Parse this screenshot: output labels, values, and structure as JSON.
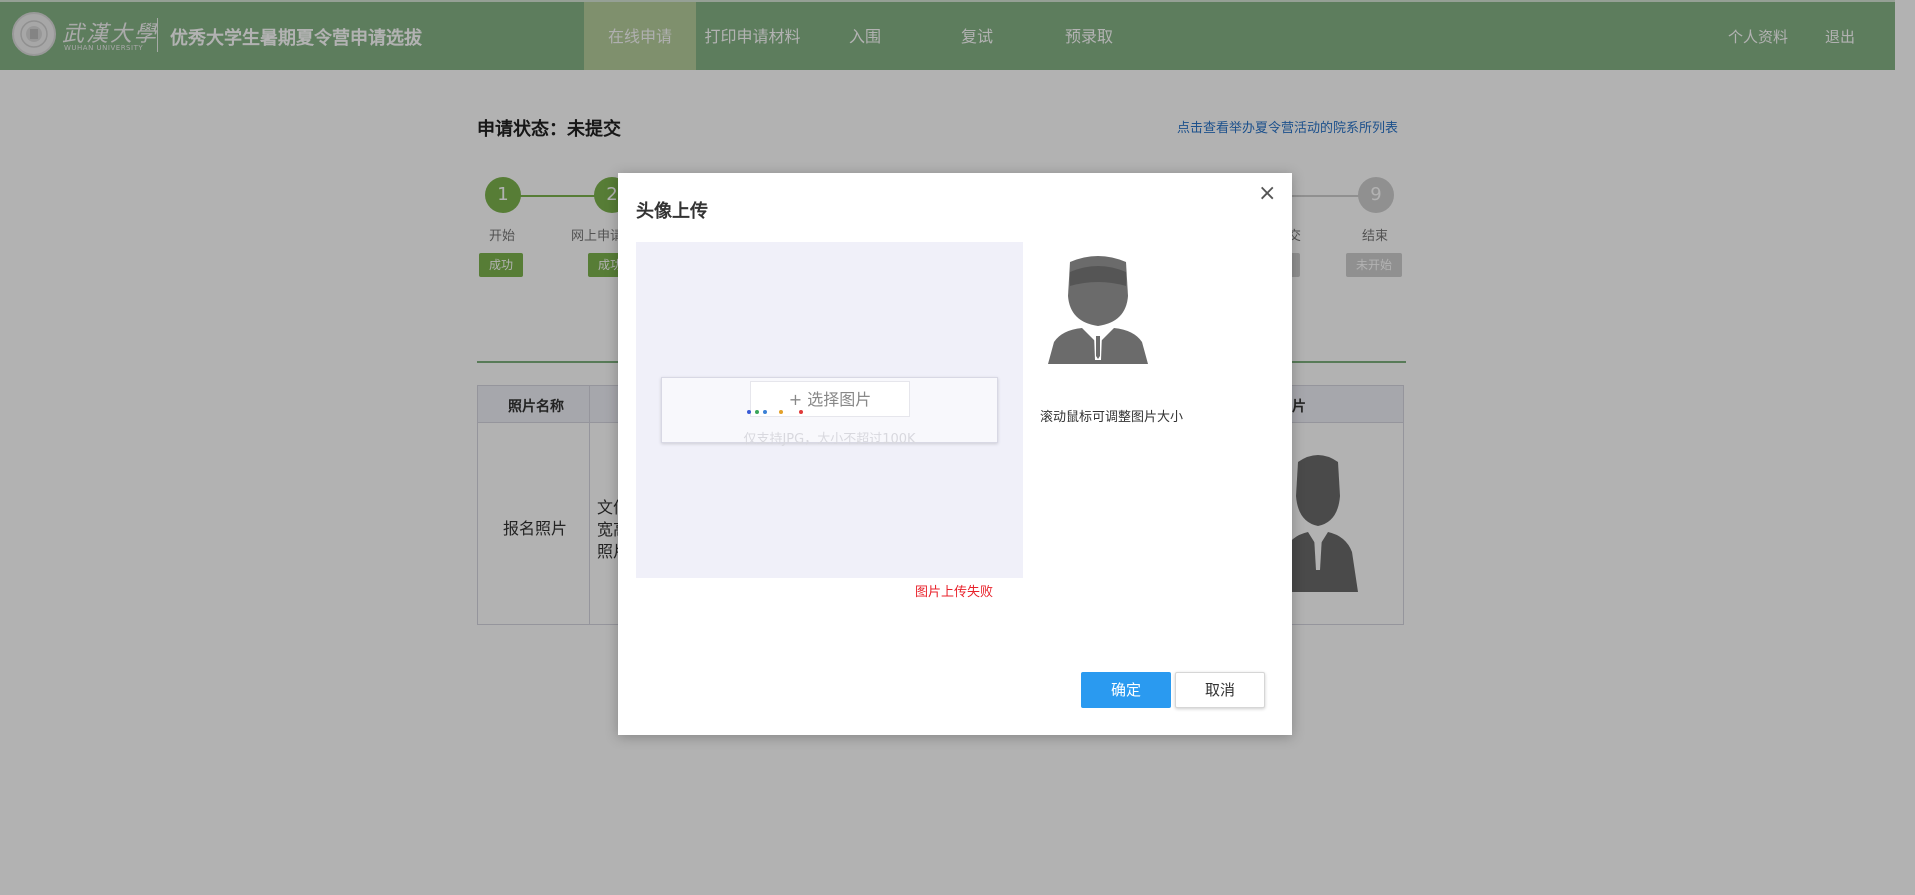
{
  "header": {
    "logo_cn": "武漢大學",
    "logo_en": "WUHAN UNIVERSITY",
    "title": "优秀大学生暑期夏令营申请选拔",
    "nav": [
      {
        "label": "在线申请",
        "active": true
      },
      {
        "label": "打印申请材料",
        "active": false
      },
      {
        "label": "入围",
        "active": false
      },
      {
        "label": "复试",
        "active": false
      },
      {
        "label": "预录取",
        "active": false
      }
    ],
    "profile_label": "个人资料",
    "logout_label": "退出"
  },
  "page": {
    "status_label": "申请状态：未提交",
    "dept_link": "点击查看举办夏令营活动的院系所列表",
    "steps": [
      {
        "number": "1",
        "name": "开始",
        "badge": "成功"
      },
      {
        "number": "2",
        "name": "网上申请",
        "badge": "成功"
      },
      {
        "number": "9",
        "name": "结束",
        "badge": "未开始"
      }
    ],
    "step_partial_name": "交",
    "table": {
      "col_photo_name": "照片名称",
      "col_photo": "照片",
      "row_label": "报名照片",
      "row_desc_lines": [
        "文件",
        "宽高",
        "照片"
      ]
    }
  },
  "modal": {
    "title": "头像上传",
    "close_glyph": "×",
    "select_button": "+ 选择图片",
    "hint": "仅支持JPG，大小不超过100K",
    "error": "图片上传失败",
    "scroll_hint": "滚动鼠标可调整图片大小",
    "ok_label": "确定",
    "cancel_label": "取消"
  },
  "colors": {
    "header_bg": "#86b386",
    "nav_active_bg": "#b7cf9d",
    "step_done": "#7db44e",
    "step_pending": "#cfcfcf",
    "primary_button": "#2a9af0",
    "error_text": "#e8222b",
    "link": "#2a74c9"
  }
}
